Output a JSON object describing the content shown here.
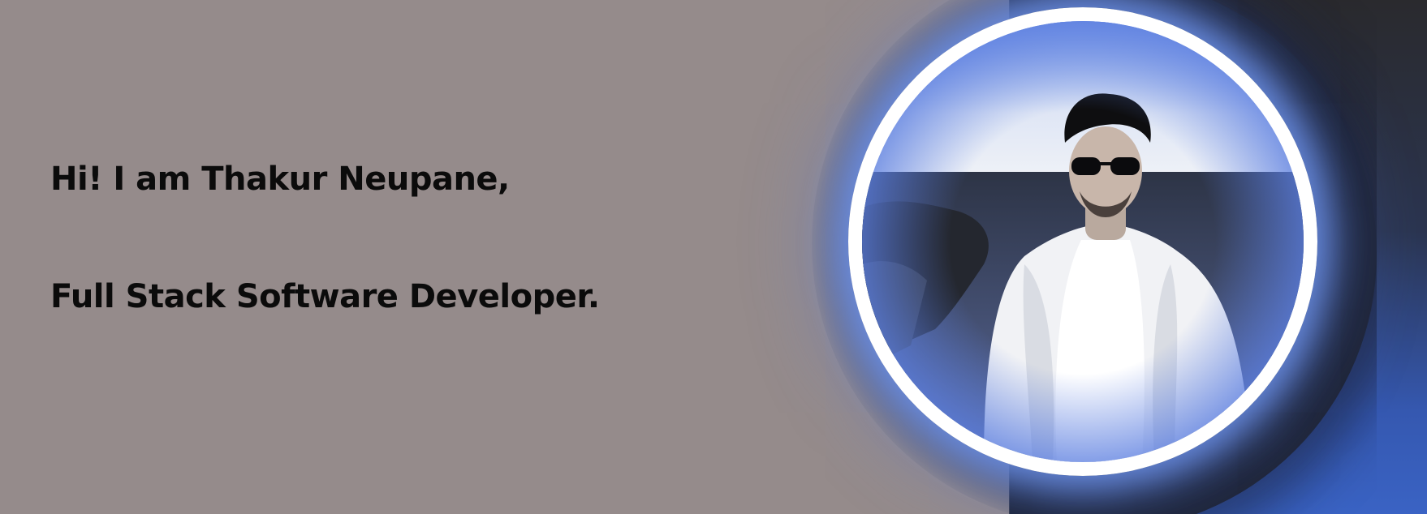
{
  "hero": {
    "greeting": "Hi! I am Thakur Neupane,",
    "role": "Full Stack Software Developer."
  },
  "colors": {
    "background": "#958b8b",
    "text": "#0b0b0b",
    "accent_blue": "#3a63c4",
    "ring": "#ffffff",
    "glow": "#78a0ff"
  },
  "profile_photo": {
    "icon": "profile-photo"
  }
}
